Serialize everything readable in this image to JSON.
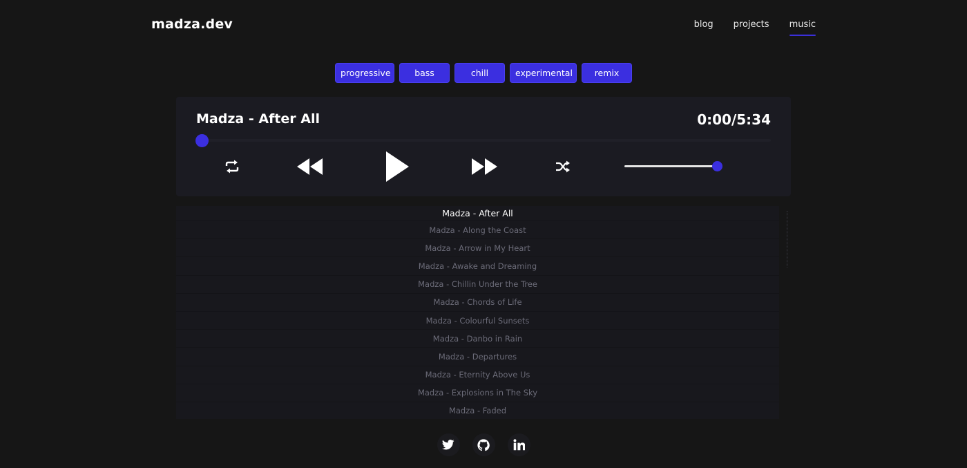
{
  "header": {
    "logo": "madza.dev",
    "nav": [
      {
        "label": "blog",
        "active": false
      },
      {
        "label": "projects",
        "active": false
      },
      {
        "label": "music",
        "active": true
      }
    ]
  },
  "tags": [
    "progressive",
    "bass",
    "chill",
    "experimental",
    "remix"
  ],
  "player": {
    "title": "Madza - After All",
    "time": "0:00/5:34",
    "progress": 0,
    "volume": 1.0,
    "accent": "#3b2fe0"
  },
  "playlist": [
    "Madza - After All",
    "Madza - Along the Coast",
    "Madza - Arrow in My Heart",
    "Madza - Awake and Dreaming",
    "Madza - Chillin Under the Tree",
    "Madza - Chords of Life",
    "Madza - Colourful Sunsets",
    "Madza - Danbo in Rain",
    "Madza - Departures",
    "Madza - Eternity Above Us",
    "Madza - Explosions in The Sky",
    "Madza - Faded"
  ],
  "social": [
    "twitter-icon",
    "github-icon",
    "linkedin-icon"
  ]
}
